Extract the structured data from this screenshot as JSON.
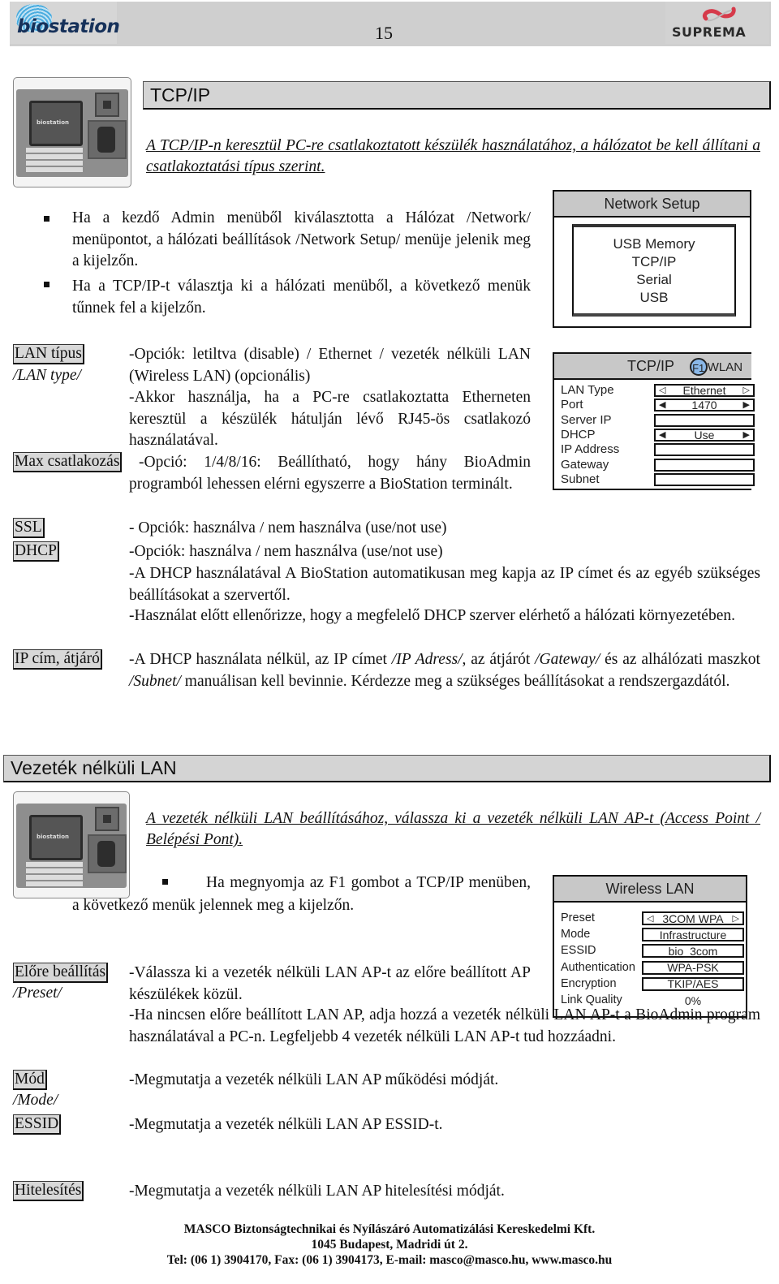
{
  "header": {
    "logo_left": "biostation",
    "page_number": "15",
    "logo_right": "SUPREMA"
  },
  "tcpip_section": {
    "title": "TCP/IP",
    "intro": "A TCP/IP-n keresztül PC-re csatlakoztatott készülék használatához, a hálózatot be kell állítani a csatlakoztatási típus szerint.",
    "bullets": [
      "Ha a kezdő Admin menüből kiválasztotta a Hálózat /Network/ menüpontot, a hálózati beállítások /Network Setup/ menüje jelenik meg a kijelzőn.",
      "Ha a TCP/IP-t választja ki a hálózati menüből, a következő menük tűnnek fel a kijelzőn."
    ],
    "network_setup_screen": {
      "title": "Network Setup",
      "items": [
        "USB Memory",
        "TCP/IP",
        "Serial",
        "USB"
      ]
    },
    "tcpip_screen": {
      "title": "TCP/IP",
      "f1_badge": "F1",
      "f1_label": "WLAN",
      "rows": [
        {
          "label": "LAN Type",
          "value": "Ethernet",
          "left_arrow": "◁",
          "right_arrow": "▷"
        },
        {
          "label": "Port",
          "value": "1470",
          "left_arrow": "◀",
          "right_arrow": "▶"
        },
        {
          "label": "Server IP",
          "value": ""
        },
        {
          "label": "DHCP",
          "value": "Use",
          "left_arrow": "◀",
          "right_arrow": "▶"
        },
        {
          "label": "IP Address",
          "value": ""
        },
        {
          "label": "Gateway",
          "value": ""
        },
        {
          "label": "Subnet",
          "value": ""
        }
      ]
    },
    "definitions": [
      {
        "term": "LAN típus",
        "subterm": "/LAN type/",
        "text": "-Opciók: letiltva (disable) / Ethernet / vezeték nélküli LAN (Wireless LAN) (opcionális)\n-Akkor használja, ha a PC-re csatlakoztatta Etherneten keresztül a készülék hátulján lévő RJ45-ös csatlakozó használatával."
      },
      {
        "term": "Max csatlakozás",
        "text": "-Opció: 1/4/8/16: Beállítható, hogy hány BioAdmin programból lehessen elérni egyszerre a BioStation terminált."
      },
      {
        "term": "SSL",
        "text": "- Opciók: használva / nem használva (use/not use)"
      },
      {
        "term": "DHCP",
        "text": "-Opciók: használva / nem használva (use/not use)",
        "extra": [
          "-A DHCP használatával A BioStation automatikusan meg kapja az IP címet és az egyéb szükséges beállításokat a szervertől.",
          "-Használat előtt ellenőrizze, hogy a megfelelő DHCP szerver elérhető a hálózati környezetében."
        ]
      },
      {
        "term": "IP cím, átjáró",
        "text_parts": [
          "-A DHCP használata nélkül, az IP címet ",
          "/IP Adress/",
          ", az átjárót ",
          "/Gateway/",
          " és az alhálózati maszkot ",
          "/Subnet/",
          " manuálisan kell bevinnie. Kérdezze meg a szükséges beállításokat a rendszergazdától."
        ]
      }
    ]
  },
  "wlan_section": {
    "title": "Vezeték nélküli LAN",
    "intro": "A vezeték nélküli LAN beállításához, válassza ki a vezeték nélküli LAN AP-t (Access Point / Belépési Pont).",
    "bullet": "Ha megnyomja az F1 gombot a TCP/IP menüben, a következő menük jelennek meg a kijelzőn.",
    "wireless_screen": {
      "title": "Wireless LAN",
      "rows": [
        {
          "label": "Preset",
          "value": "3COM WPA",
          "left_arrow": "◁",
          "right_arrow": "▷",
          "boxed": true
        },
        {
          "label": "Mode",
          "value": "Infrastructure",
          "boxed": true
        },
        {
          "label": "ESSID",
          "value": "bio_3com",
          "boxed": true
        },
        {
          "label": "Authentication",
          "value": "WPA-PSK",
          "boxed": true
        },
        {
          "label": "Encryption",
          "value": "TKIP/AES",
          "boxed": true
        },
        {
          "label": "Link Quality",
          "value": "0%",
          "boxed": false
        }
      ]
    },
    "definitions": [
      {
        "term": "Előre beállítás",
        "subterm": "/Preset/",
        "text": "-Válassza ki a vezeték nélküli LAN AP-t az előre beállított AP készülékek közül.",
        "extra": "-Ha nincsen előre beállított LAN AP, adja hozzá a vezeték nélküli LAN AP-t a BioAdmin program használatával a PC-n. Legfeljebb 4 vezeték nélküli LAN AP-t tud hozzáadni."
      },
      {
        "term": "Mód",
        "subterm": "/Mode/",
        "text": "-Megmutatja a vezeték nélküli LAN AP működési módját."
      },
      {
        "term": "ESSID",
        "text": "-Megmutatja a vezeték nélküli LAN AP ESSID-t."
      },
      {
        "term": "Hitelesítés",
        "text": "-Megmutatja a vezeték nélküli LAN AP hitelesítési módját."
      }
    ]
  },
  "footer": {
    "company": "MASCO Biztonságtechnikai és Nyílászáró Automatizálási Kereskedelmi Kft.",
    "address": "1045 Budapest, Madridi út 2.",
    "contact": "Tel: (06 1) 3904170, Fax: (06 1) 3904173, E-mail: masco@masco.hu, www.masco.hu"
  }
}
